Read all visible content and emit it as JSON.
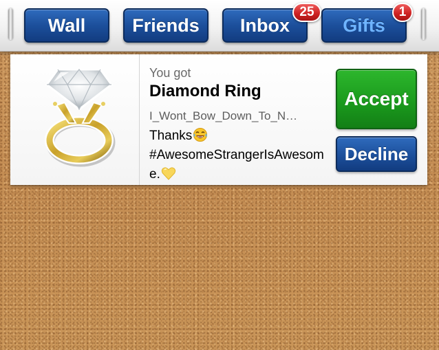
{
  "tabs": [
    {
      "label": "Wall",
      "selected": false
    },
    {
      "label": "Friends",
      "selected": false
    },
    {
      "label": "Inbox",
      "selected": false,
      "badge": "25"
    },
    {
      "label": "Gifts",
      "selected": true,
      "badge": "1"
    }
  ],
  "gift": {
    "header": "You got",
    "item_name": "Diamond Ring",
    "item_icon": "diamond-ring-icon",
    "sender": "I_Wont_Bow_Down_To_N…",
    "message_part1": "Thanks",
    "message_part2": "#AwesomeStrangerIsAwesome.",
    "emoji_1": "tears-of-joy-emoji",
    "emoji_2": "yellow-heart-emoji"
  },
  "actions": {
    "accept_label": "Accept",
    "decline_label": "Decline"
  },
  "colors": {
    "tab_blue": "#1c4f9b",
    "selected_tab_text": "#6fb4ff",
    "badge_red": "#cc2020",
    "accept_green": "#1b9b1d",
    "corkboard": "#c8945a"
  }
}
